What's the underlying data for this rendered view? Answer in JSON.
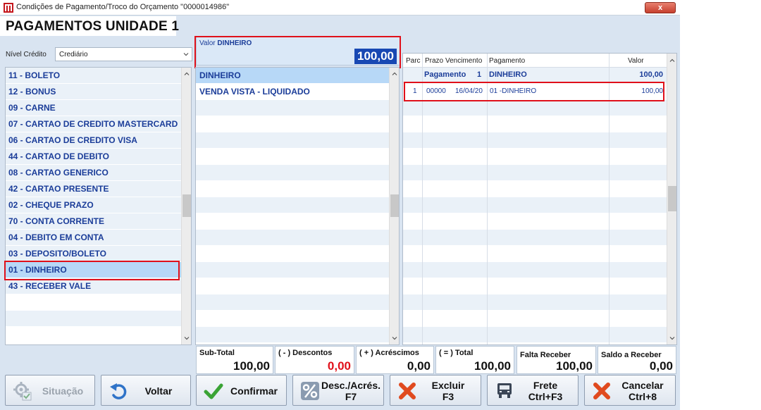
{
  "window": {
    "title": "Condições de Pagamento/Troco do Orçamento \"0000014986\"",
    "close_label": "x"
  },
  "unit_title": "PAGAMENTOS UNIDADE 1",
  "credit": {
    "label": "Nível Crédito",
    "value": "Crediário"
  },
  "payment_methods": [
    "11 - BOLETO",
    "12 - BONUS",
    "09 - CARNE",
    "07 - CARTAO DE CREDITO MASTERCARD",
    "06 - CARTAO DE CREDITO VISA",
    "44 - CARTAO DE DEBITO",
    "08 - CARTAO GENERICO",
    "42 - CARTAO PRESENTE",
    "02 - CHEQUE PRAZO",
    "70 - CONTA CORRENTE",
    "04 - DEBITO EM CONTA",
    "03 - DEPOSITO/BOLETO",
    "01 - DINHEIRO",
    "43 - RECEBER VALE"
  ],
  "value_box": {
    "label": "Valor",
    "method": "DINHEIRO",
    "amount": "100,00"
  },
  "conditions": [
    "DINHEIRO",
    "VENDA VISTA - LIQUIDADO"
  ],
  "grid": {
    "headers": {
      "parc": "Parc",
      "prazo": "Prazo",
      "vencimento": "Vencimento",
      "pagamento": "Pagamento",
      "valor": "Valor"
    },
    "group": {
      "label": "Pagamento",
      "number": "1",
      "method": "DINHEIRO",
      "valor": "100,00"
    },
    "item": {
      "parc": "1",
      "prazo": "00000",
      "vencimento": "16/04/20",
      "pagamento": "01 -DINHEIRO",
      "valor": "100,00"
    }
  },
  "totals": {
    "subtotal_label": "Sub-Total",
    "subtotal": "100,00",
    "descontos_label": "( - ) Descontos",
    "descontos": "0,00",
    "acrescimos_label": "( + ) Acréscimos",
    "acrescimos": "0,00",
    "total_label": "( = ) Total",
    "total": "100,00",
    "falta_label": "Falta Receber",
    "falta": "100,00",
    "saldo_label": "Saldo a Receber",
    "saldo": "0,00"
  },
  "buttons": {
    "situacao": "Situação",
    "voltar": "Voltar",
    "confirmar": "Confirmar",
    "desc_line1": "Desc./Acrés.",
    "desc_line2": "F7",
    "excluir_line1": "Excluir",
    "excluir_line2": "F3",
    "frete_line1": "Frete",
    "frete_line2": "Ctrl+F3",
    "cancelar_line1": "Cancelar",
    "cancelar_line2": "Ctrl+8"
  },
  "colors": {
    "accent_blue": "#1848b3",
    "list_text": "#1b3d99",
    "highlight_red": "#e0101a",
    "selected_row": "#b7d8f7"
  }
}
